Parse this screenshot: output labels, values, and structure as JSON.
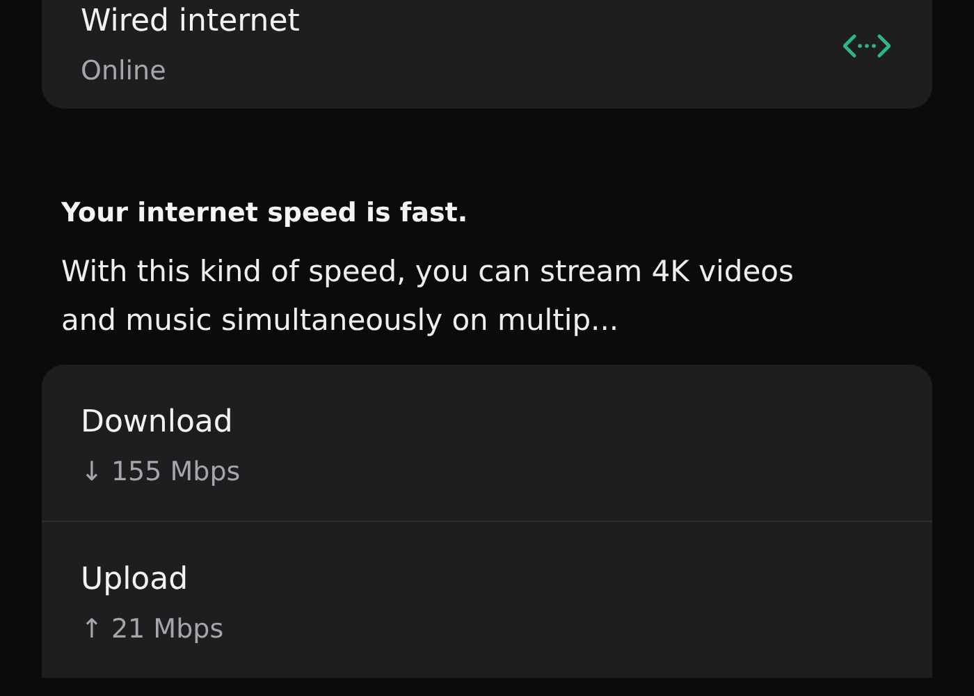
{
  "connection": {
    "title": "Wired internet",
    "status": "Online"
  },
  "summary": {
    "heading": "Your internet speed is fast.",
    "text": "With this kind of speed, you can stream 4K videos and music simultaneously on multip..."
  },
  "speeds": [
    {
      "label": "Download",
      "reading": "↓ 155 Mbps"
    },
    {
      "label": "Upload",
      "reading": "↑ 21 Mbps"
    }
  ]
}
